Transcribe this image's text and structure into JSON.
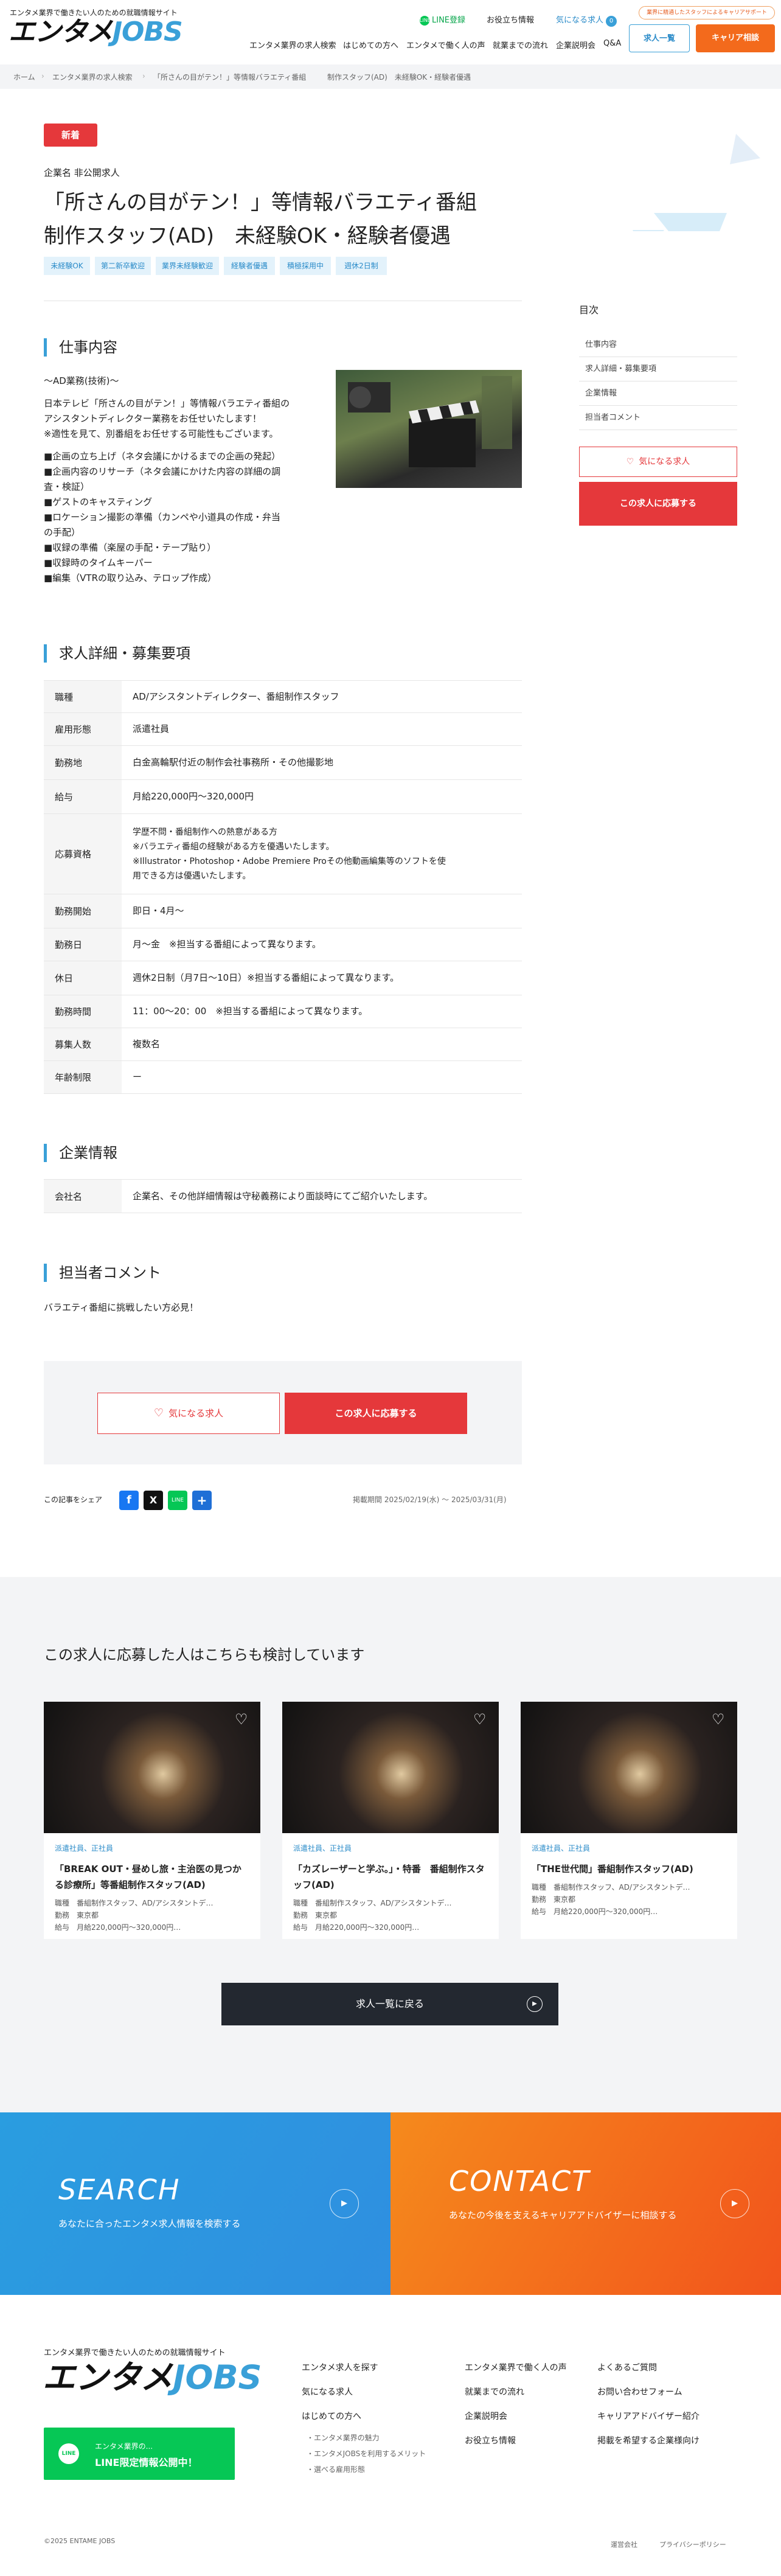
{
  "header": {
    "tagline": "エンタメ業界で働きたい人のための就職情報サイト",
    "logo_ja": "エンタメ",
    "logo_en": "JOBS",
    "ad_pill": "業界に精通したスタッフによるキャリアサポート",
    "line_label": "LINE登録",
    "useful_label": "お役立ち情報",
    "favorites_label": "気になる求人",
    "favorites_count": "0",
    "nav": [
      "エンタメ業界の求人検索",
      "はじめての方へ",
      "エンタメで働く人の声",
      "就業までの流れ",
      "企業説明会",
      "Q&A"
    ],
    "btn_list": "求人一覧",
    "btn_career": "キャリア相談"
  },
  "breadcrumb": [
    "ホーム",
    "エンタメ業界の求人検索",
    "「所さんの目がテン！」等情報バラエティ番組",
    "制作スタッフ(AD)　未経験OK・経験者優遇"
  ],
  "job": {
    "new_badge": "新着",
    "company": "企業名 非公開求人",
    "title_line1": "「所さんの目がテン！」等情報バラエティ番組",
    "title_line2": "制作スタッフ(AD)　未経験OK・経験者優遇",
    "tags": [
      "未経験OK",
      "第二新卒歓迎",
      "業界未経験歓迎",
      "経験者優遇",
      "積極採用中",
      "週休2日制"
    ]
  },
  "work": {
    "heading": "仕事内容",
    "lines": [
      "〜AD業務(技術)〜",
      "",
      "日本テレビ「所さんの目がテン！」等情報バラエティ番組の",
      "アシスタントディレクター業務をお任せいたします！",
      "※適性を見て、別番組をお任せする可能性もございます。",
      "",
      "■企画の立ち上げ（ネタ会議にかけるまでの企画の発起）",
      "■企画内容のリサーチ（ネタ会議にかけた内容の詳細の調",
      "査・検証）",
      "■ゲストのキャスティング",
      "■ロケーション撮影の準備（カンペや小道具の作成・弁当",
      "の手配）",
      "■収録の準備（楽屋の手配・テープ貼り）",
      "■収録時のタイムキーパー",
      "■編集（VTRの取り込み、テロップ作成）"
    ]
  },
  "details": {
    "heading": "求人詳細・募集要項",
    "rows": [
      {
        "label": "職種",
        "value": "AD/アシスタントディレクター、番組制作スタッフ"
      },
      {
        "label": "雇用形態",
        "value": "派遣社員"
      },
      {
        "label": "勤務地",
        "value": "白金高輪駅付近の制作会社事務所・その他撮影地"
      },
      {
        "label": "給与",
        "value": "月給220,000円〜320,000円"
      },
      {
        "label": "応募資格",
        "value": "学歴不問・番組制作への熱意がある方\n※バラエティ番組の経験がある方を優遇いたします。\n※Illustrator・Photoshop・Adobe Premiere Proその他動画編集等のソフトを使\n用できる方は優遇いたします。"
      },
      {
        "label": "勤務開始",
        "value": "即日・4月〜"
      },
      {
        "label": "勤務日",
        "value": "月〜金　※担当する番組によって異なります。"
      },
      {
        "label": "休日",
        "value": "週休2日制（月7日〜10日）※担当する番組によって異なります。"
      },
      {
        "label": "勤務時間",
        "value": "11：00〜20：00　※担当する番組によって異なります。"
      },
      {
        "label": "募集人数",
        "value": "複数名"
      },
      {
        "label": "年齢制限",
        "value": "ー"
      }
    ]
  },
  "company": {
    "heading": "企業情報",
    "label": "会社名",
    "value": "企業名、その他詳細情報は守秘義務により面談時にてご紹介いたします。"
  },
  "comment": {
    "heading": "担当者コメント",
    "text": "バラエティ番組に挑戦したい方必見！"
  },
  "actions": {
    "fav": "気になる求人",
    "apply": "この求人に応募する"
  },
  "share": {
    "label": "この記事をシェア",
    "period": "掲載期間 2025/02/19(水) 〜 2025/03/31(月)"
  },
  "sidebar": {
    "title": "目次",
    "items": [
      "仕事内容",
      "求人詳細・募集要項",
      "企業情報",
      "担当者コメント"
    ],
    "fav": "気になる求人",
    "apply": "この求人に応募する"
  },
  "related": {
    "heading": "この求人に応募した人はこちらも検討しています",
    "cards": [
      {
        "badge": "派遣社員、正社員",
        "title": "「BREAK OUT・昼めし旅・主治医の見つかる診療所」等番組制作スタッフ(AD)",
        "role": "職種　番組制作スタッフ、AD/アシスタントデ…",
        "place": "勤務　東京都",
        "pay": "給与　月給220,000円〜320,000円…"
      },
      {
        "badge": "派遣社員、正社員",
        "title": "「カズレーザーと学ぶ。」・特番　番組制作スタッフ(AD)",
        "role": "職種　番組制作スタッフ、AD/アシスタントデ…",
        "place": "勤務　東京都",
        "pay": "給与　月給220,000円〜320,000円…"
      },
      {
        "badge": "派遣社員、正社員",
        "title": "「THE世代間」番組制作スタッフ(AD)",
        "role": "職種　番組制作スタッフ、AD/アシスタントデ…",
        "place": "勤務　東京都",
        "pay": "給与　月給220,000円〜320,000円…"
      }
    ],
    "back": "求人一覧に戻る"
  },
  "cta": {
    "search_big": "SEARCH",
    "search_sub": "あなたに合ったエンタメ求人情報を検索する",
    "contact_big": "CONTACT",
    "contact_sub": "あなたの今後を支えるキャリアアドバイザーに相談する"
  },
  "footer": {
    "tagline": "エンタメ業界で働きたい人のための就職情報サイト",
    "line_small": "エンタメ業界の...",
    "line_big": "LINE限定情報公開中！",
    "col1": [
      "エンタメ求人を探す",
      "気になる求人",
      "はじめての方へ"
    ],
    "col1_sub": [
      "・エンタメ業界の魅力",
      "・エンタメJOBSを利用するメリット",
      "・選べる雇用形態"
    ],
    "col2": [
      "エンタメ業界で働く人の声",
      "就業までの流れ",
      "企業説明会",
      "お役立ち情報"
    ],
    "col3": [
      "よくあるご質問",
      "お問い合わせフォーム",
      "キャリアアドバイザー紹介",
      "掲載を希望する企業様向け"
    ],
    "copyright": "©2025 ENTAME JOBS",
    "company_link": "運営会社",
    "privacy": "プライバシーポリシー"
  },
  "colors": {
    "accent_blue": "#3aa0d8",
    "accent_red": "#e5383b",
    "accent_orange": "#f36a1c"
  }
}
